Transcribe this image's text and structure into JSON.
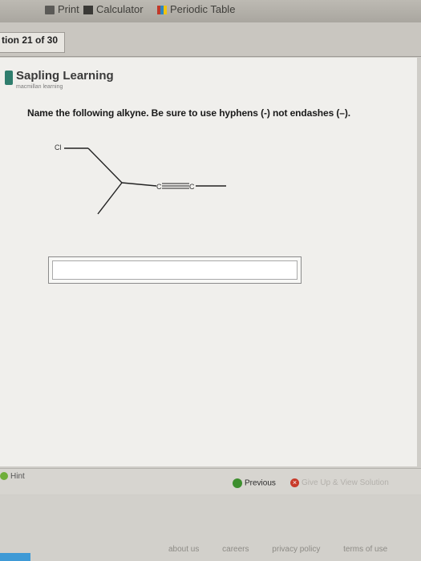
{
  "toolbar": {
    "items": [
      {
        "label": "Print",
        "icon": "printer-icon"
      },
      {
        "label": "Calculator",
        "icon": "calculator-icon"
      },
      {
        "label": "Periodic Table",
        "icon": "periodic-table-icon"
      }
    ]
  },
  "question_counter": "tion 21 of 30",
  "brand": {
    "name": "Sapling Learning",
    "subtitle": "macmillan learning",
    "color": "#2f7d6d"
  },
  "question": {
    "prompt": "Name the following alkyne. Be sure to use hyphens (-) not endashes (–).",
    "molecule": {
      "atom_labels": [
        "Cl",
        "C",
        "C"
      ]
    }
  },
  "answer": {
    "value": "",
    "placeholder": ""
  },
  "actions": {
    "hint": "Hint",
    "previous": "Previous",
    "give_up": "Give Up & View Solution"
  },
  "footer_links": [
    "about us",
    "careers",
    "privacy policy",
    "terms of use"
  ]
}
